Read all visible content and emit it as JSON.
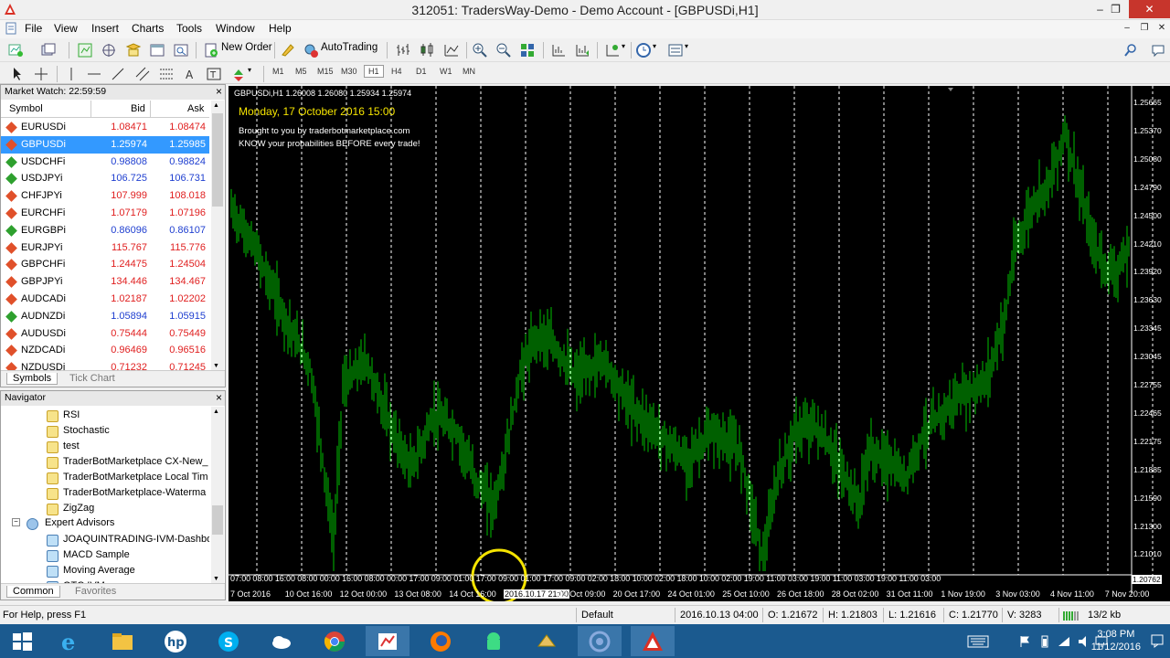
{
  "window": {
    "title": "312051: TradersWay-Demo - Demo Account - [GBPUSDi,H1]",
    "buttons": [
      "–",
      "❐",
      "✕"
    ],
    "mdi_buttons": [
      "–",
      "❐",
      "✕"
    ]
  },
  "menu": [
    "File",
    "View",
    "Insert",
    "Charts",
    "Tools",
    "Window",
    "Help"
  ],
  "toolbar": {
    "new_order": "New Order",
    "autotrading": "AutoTrading",
    "timeframes": [
      "M1",
      "M5",
      "M15",
      "M30",
      "H1",
      "H4",
      "D1",
      "W1",
      "MN"
    ],
    "active_timeframe": "H1"
  },
  "market_watch": {
    "title": "Market Watch: 22:59:59",
    "columns": [
      "Symbol",
      "Bid",
      "Ask"
    ],
    "rows": [
      {
        "symbol": "EURUSDi",
        "bid": "1.08471",
        "ask": "1.08474",
        "dir": "down"
      },
      {
        "symbol": "GBPUSDi",
        "bid": "1.25974",
        "ask": "1.25985",
        "dir": "down",
        "selected": true
      },
      {
        "symbol": "USDCHFi",
        "bid": "0.98808",
        "ask": "0.98824",
        "dir": "up"
      },
      {
        "symbol": "USDJPYi",
        "bid": "106.725",
        "ask": "106.731",
        "dir": "up"
      },
      {
        "symbol": "CHFJPYi",
        "bid": "107.999",
        "ask": "108.018",
        "dir": "down"
      },
      {
        "symbol": "EURCHFi",
        "bid": "1.07179",
        "ask": "1.07196",
        "dir": "down"
      },
      {
        "symbol": "EURGBPi",
        "bid": "0.86096",
        "ask": "0.86107",
        "dir": "up"
      },
      {
        "symbol": "EURJPYi",
        "bid": "115.767",
        "ask": "115.776",
        "dir": "down"
      },
      {
        "symbol": "GBPCHFi",
        "bid": "1.24475",
        "ask": "1.24504",
        "dir": "down"
      },
      {
        "symbol": "GBPJPYi",
        "bid": "134.446",
        "ask": "134.467",
        "dir": "down"
      },
      {
        "symbol": "AUDCADi",
        "bid": "1.02187",
        "ask": "1.02202",
        "dir": "down"
      },
      {
        "symbol": "AUDNZDi",
        "bid": "1.05894",
        "ask": "1.05915",
        "dir": "up"
      },
      {
        "symbol": "AUDUSDi",
        "bid": "0.75444",
        "ask": "0.75449",
        "dir": "down"
      },
      {
        "symbol": "NZDCADi",
        "bid": "0.96469",
        "ask": "0.96516",
        "dir": "down"
      },
      {
        "symbol": "NZDUSDi",
        "bid": "0.71232",
        "ask": "0.71245",
        "dir": "down"
      }
    ],
    "tabs": [
      "Symbols",
      "Tick Chart"
    ]
  },
  "navigator": {
    "title": "Navigator",
    "indicators": [
      "RSI",
      "Stochastic",
      "test",
      "TraderBotMarketplace CX-New_",
      "TraderBotMarketplace Local Tim",
      "TraderBotMarketplace-Waterma",
      "ZigZag"
    ],
    "expert_advisors_label": "Expert Advisors",
    "experts": [
      "JOAQUINTRADING-IVM-Dashbo",
      "MACD Sample",
      "Moving Average",
      "OTC IVM"
    ],
    "tabs": [
      "Common",
      "Favorites"
    ]
  },
  "chart": {
    "header": "GBPUSDi,H1  1.26008 1.26080 1.25934 1.25974",
    "date_overlay": "Monday, 17 October 2016 15:00",
    "watermark_line1": "Brought to you by traderbotmarketplace.com",
    "watermark_line2": "KNOW your probabilities BEFORE every trade!",
    "price_labels": [
      "1.25665",
      "1.25370",
      "1.25080",
      "1.24790",
      "1.24500",
      "1.24210",
      "1.23920",
      "1.23630",
      "1.23345",
      "1.23045",
      "1.22755",
      "1.22465",
      "1.22175",
      "1.21885",
      "1.21590",
      "1.21300",
      "1.21010"
    ],
    "current_price_tag": "1.20762",
    "session_labels": "07:00 08:00 16:00 08:00 00:00 16:00 08:00 00:00 17:00 09:00 01:00 17:00 09:00 01:00 17:00 09:00 02:00 18:00 10:00 02:00 18:00 10:00 02:00 19:00 11:00 03:00 19:00 11:00 03:00 19:00 11:00 03:00",
    "date_labels": [
      "7 Oct 2016",
      "10 Oct 16:00",
      "12 Oct 00:00",
      "13 Oct 08:00",
      "14 Oct 16:00",
      "2016.10.17 21:00",
      "19 Oct 09:00",
      "20 Oct 17:00",
      "24 Oct 01:00",
      "25 Oct 10:00",
      "26 Oct 18:00",
      "28 Oct 02:00",
      "31 Oct 11:00",
      "1 Nov 19:00",
      "3 Nov 03:00",
      "4 Nov 11:00",
      "7 Nov 20:00"
    ],
    "candle_color": "#00c000",
    "grid_color": "#ffffff",
    "cursor_highlight_color": "#f5e400"
  },
  "status": {
    "help": "For Help, press F1",
    "profile": "Default",
    "datetime": "2016.10.13 04:00",
    "open": "O: 1.21672",
    "high": "H: 1.21803",
    "low": "L: 1.21616",
    "close": "C: 1.21770",
    "volume": "V: 3283",
    "traffic": "13/2 kb"
  },
  "taskbar": {
    "time": "3:08 PM",
    "date": "11/12/2016",
    "apps": [
      "start-icon",
      "internet-explorer-icon",
      "file-explorer-icon",
      "hp-icon",
      "skype-icon",
      "onedrive-icon",
      "chrome-icon",
      "task-app-icon",
      "firefox-icon",
      "android-icon",
      "gold-app-icon",
      "circle-app-icon",
      "mt4-icon"
    ]
  }
}
